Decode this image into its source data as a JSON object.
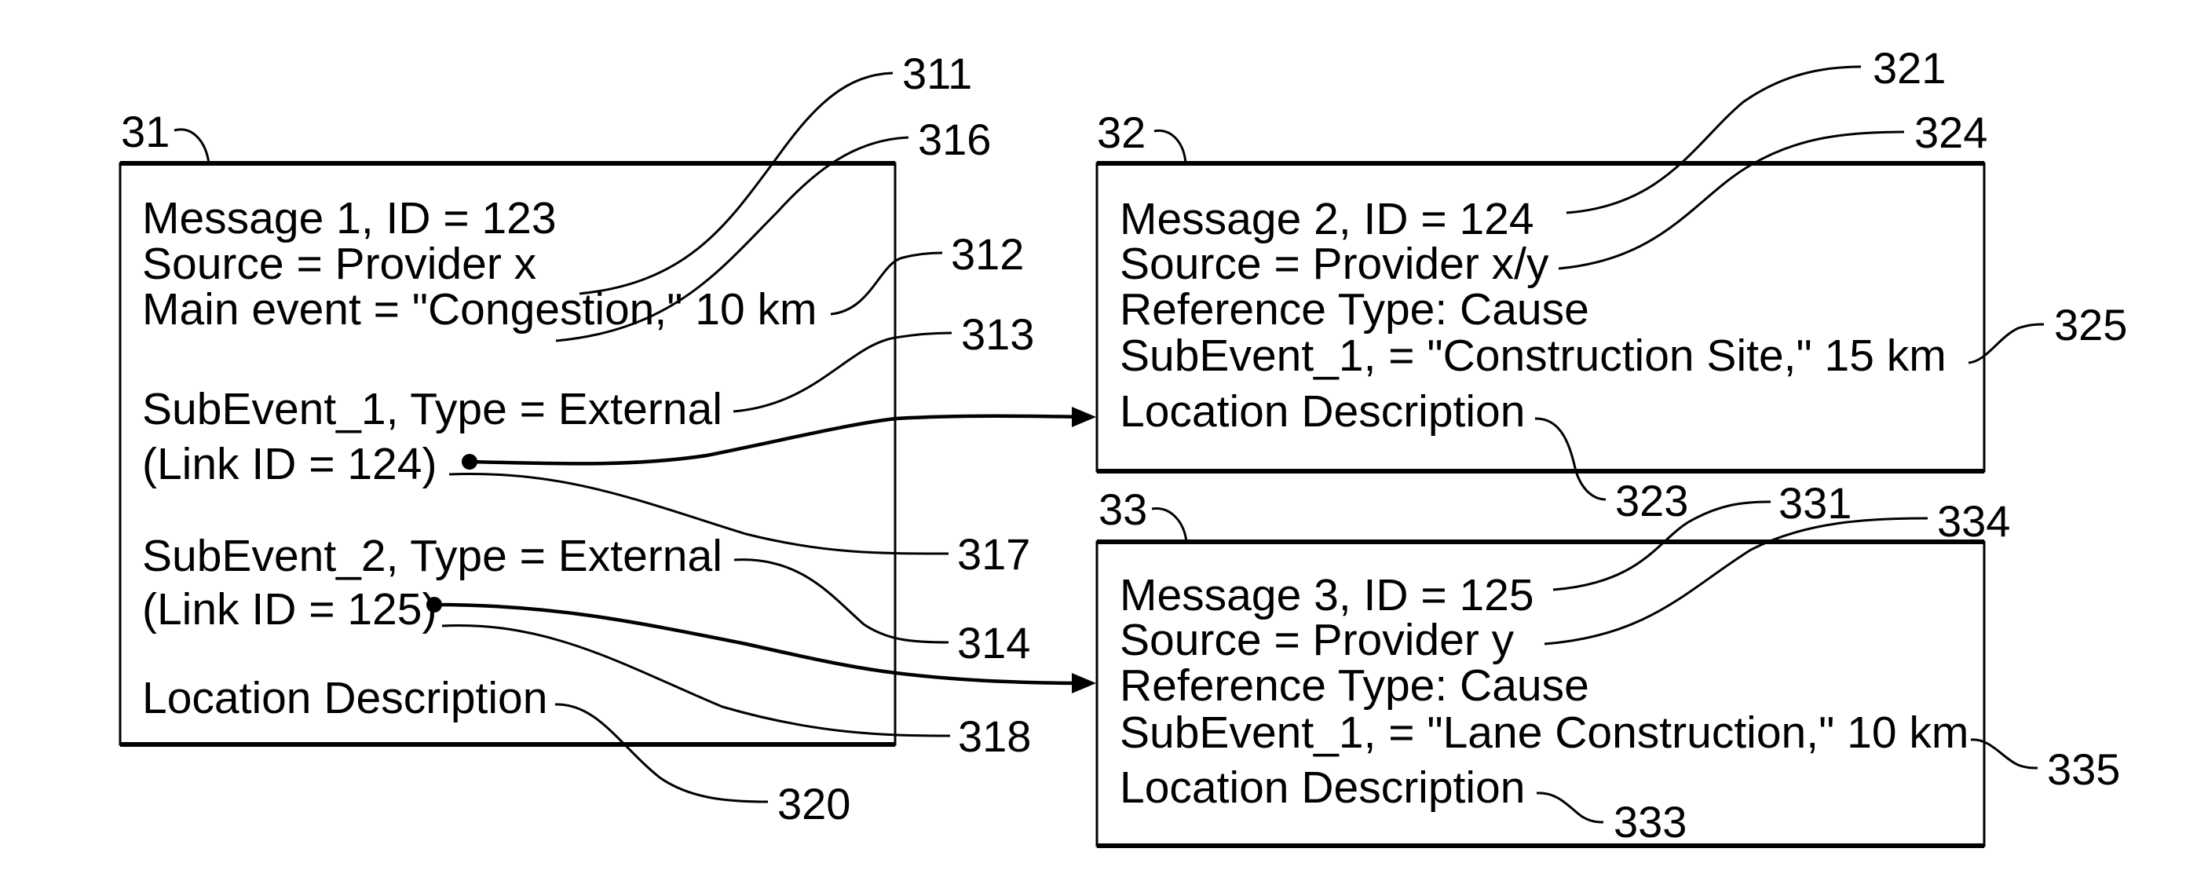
{
  "figure": {
    "messages": [
      {
        "ref": "31",
        "lines": [
          "Message 1, ID = 123",
          "Source = Provider x",
          "Main event = \"Congestion,\" 10 km",
          "SubEvent_1, Type = External",
          "(Link ID = 124)",
          "SubEvent_2, Type = External",
          "(Link ID = 125)",
          "Location Description"
        ],
        "line_refs": {
          "message_id": "311",
          "source": "316",
          "main_event": "312",
          "subevent_1": "313",
          "link_124": "317",
          "subevent_2": "314",
          "link_125": "318",
          "location": "320"
        }
      },
      {
        "ref": "32",
        "lines": [
          "Message 2, ID = 124",
          "Source = Provider x/y",
          "Reference Type: Cause",
          "SubEvent_1, = \"Construction Site,\" 15 km",
          "Location Description"
        ],
        "line_refs": {
          "message_id": "321",
          "source": "324",
          "subevent_1": "325",
          "location": "323"
        }
      },
      {
        "ref": "33",
        "lines": [
          "Message 3, ID = 125",
          "Source = Provider y",
          "Reference Type: Cause",
          "SubEvent_1, = \"Lane Construction,\" 10 km",
          "Location Description"
        ],
        "line_refs": {
          "message_id": "331",
          "source": "334",
          "subevent_1": "335",
          "location": "333"
        }
      }
    ],
    "links": [
      {
        "from": "Message 1 (Link ID = 124)",
        "to": "Message 2"
      },
      {
        "from": "Message 1 (Link ID = 125)",
        "to": "Message 3"
      }
    ]
  }
}
